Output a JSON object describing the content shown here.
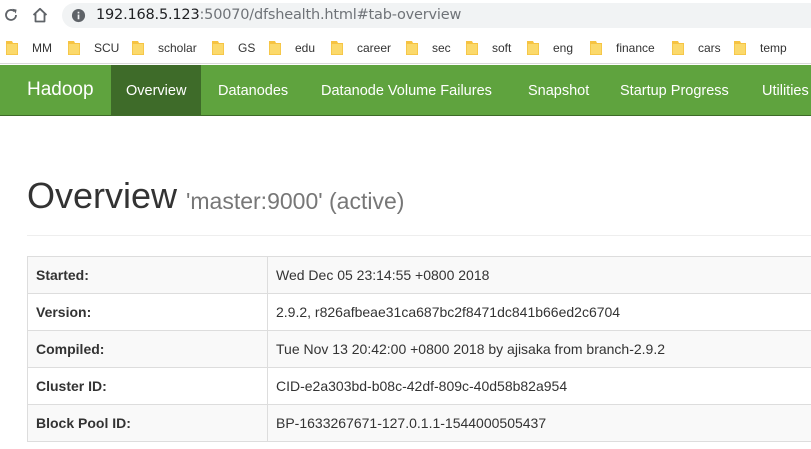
{
  "browser": {
    "url_host": "192.168.5.123",
    "url_rest": ":50070/dfshealth.html#tab-overview",
    "bookmarks": [
      "MM",
      "SCU",
      "scholar",
      "GS",
      "edu",
      "career",
      "sec",
      "soft",
      "eng",
      "finance",
      "cars",
      "temp"
    ]
  },
  "navbar": {
    "brand": "Hadoop",
    "tabs": [
      "Overview",
      "Datanodes",
      "Datanode Volume Failures",
      "Snapshot",
      "Startup Progress",
      "Utilities"
    ],
    "active_tab": "Overview"
  },
  "header": {
    "title": "Overview",
    "subtitle": "'master:9000' (active)"
  },
  "overview": {
    "rows": [
      {
        "label": "Started:",
        "value": "Wed Dec 05 23:14:55 +0800 2018"
      },
      {
        "label": "Version:",
        "value": "2.9.2, r826afbeae31ca687bc2f8471dc841b66ed2c6704"
      },
      {
        "label": "Compiled:",
        "value": "Tue Nov 13 20:42:00 +0800 2018 by ajisaka from branch-2.9.2"
      },
      {
        "label": "Cluster ID:",
        "value": "CID-e2a303bd-b08c-42df-809c-40d58b82a954"
      },
      {
        "label": "Block Pool ID:",
        "value": "BP-1633267671-127.0.1.1-1544000505437"
      }
    ]
  },
  "colors": {
    "navbar": "#5fa33e",
    "navbar_active": "#3e6b29",
    "folder": "#f6c342"
  }
}
